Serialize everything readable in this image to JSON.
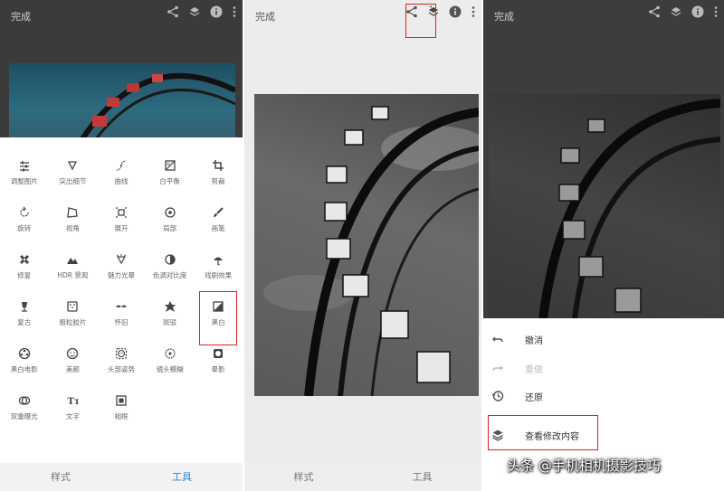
{
  "panel1": {
    "done_label": "完成",
    "tools": [
      {
        "icon": "tune-icon",
        "label": "调整图片"
      },
      {
        "icon": "details-icon",
        "label": "突出细节"
      },
      {
        "icon": "curves-icon",
        "label": "曲线"
      },
      {
        "icon": "white-balance-icon",
        "label": "白平衡"
      },
      {
        "icon": "crop-icon",
        "label": "剪裁"
      },
      {
        "icon": "rotate-icon",
        "label": "旋转"
      },
      {
        "icon": "perspective-icon",
        "label": "视角"
      },
      {
        "icon": "expand-icon",
        "label": "展开"
      },
      {
        "icon": "selective-icon",
        "label": "局部"
      },
      {
        "icon": "brush-icon",
        "label": "画笔"
      },
      {
        "icon": "healing-icon",
        "label": "修复"
      },
      {
        "icon": "hdr-icon",
        "label": "HDR 景观"
      },
      {
        "icon": "glamour-glow-icon",
        "label": "魅力光晕"
      },
      {
        "icon": "tonal-contrast-icon",
        "label": "色调对比度"
      },
      {
        "icon": "drama-icon",
        "label": "戏剧效果"
      },
      {
        "icon": "vintage-icon",
        "label": "复古"
      },
      {
        "icon": "grainy-film-icon",
        "label": "粗粒胶片"
      },
      {
        "icon": "retrolux-icon",
        "label": "怀旧"
      },
      {
        "icon": "grunge-icon",
        "label": "斑驳"
      },
      {
        "icon": "black-white-icon",
        "label": "黑白"
      },
      {
        "icon": "noir-icon",
        "label": "黑白电影"
      },
      {
        "icon": "portrait-icon",
        "label": "美颜"
      },
      {
        "icon": "head-pose-icon",
        "label": "头部姿势"
      },
      {
        "icon": "lens-blur-icon",
        "label": "镜头模糊"
      },
      {
        "icon": "vignette-icon",
        "label": "晕影"
      },
      {
        "icon": "double-exposure-icon",
        "label": "双重曝光"
      },
      {
        "icon": "text-icon",
        "label": "文字"
      },
      {
        "icon": "frames-icon",
        "label": "相框"
      }
    ],
    "tabs": {
      "styles": "样式",
      "tools": "工具"
    },
    "highlighted_tool": "黑白"
  },
  "panel2": {
    "done_label": "完成",
    "tabs": {
      "styles": "样式",
      "tools": "工具"
    }
  },
  "panel3": {
    "done_label": "完成",
    "menu": {
      "undo": "撤消",
      "redo": "重做",
      "revert": "还原",
      "view_edits": "查看修改内容"
    }
  },
  "watermark": "头条 @手机相机摄影技巧",
  "colors": {
    "accent": "#2f86d6",
    "highlight": "#e02020"
  }
}
